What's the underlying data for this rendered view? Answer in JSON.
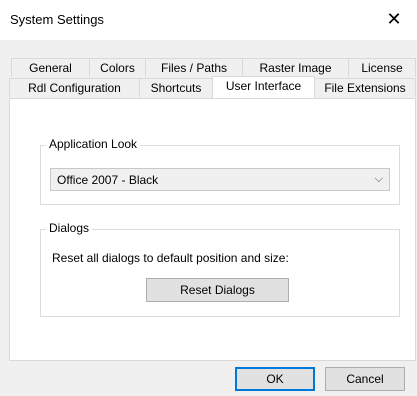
{
  "window": {
    "title": "System Settings",
    "close_glyph": "✕"
  },
  "tabs": {
    "row1": [
      "General",
      "Colors",
      "Files / Paths",
      "Raster Image",
      "License"
    ],
    "row2": [
      "Rdl Configuration",
      "Shortcuts",
      "User Interface",
      "File Extensions"
    ],
    "active": "User Interface"
  },
  "application_look": {
    "legend": "Application Look",
    "selected": "Office 2007 - Black",
    "dropdown_icon": "chevron-down-icon"
  },
  "dialogs": {
    "legend": "Dialogs",
    "description": "Reset all dialogs to default position and size:",
    "reset_button": "Reset Dialogs"
  },
  "footer": {
    "ok": "OK",
    "cancel": "Cancel"
  },
  "colors": {
    "dialog_bg": "#f0f0f0",
    "panel_bg": "#ffffff",
    "button_bg": "#e1e1e1",
    "default_button_border": "#0078d7"
  }
}
